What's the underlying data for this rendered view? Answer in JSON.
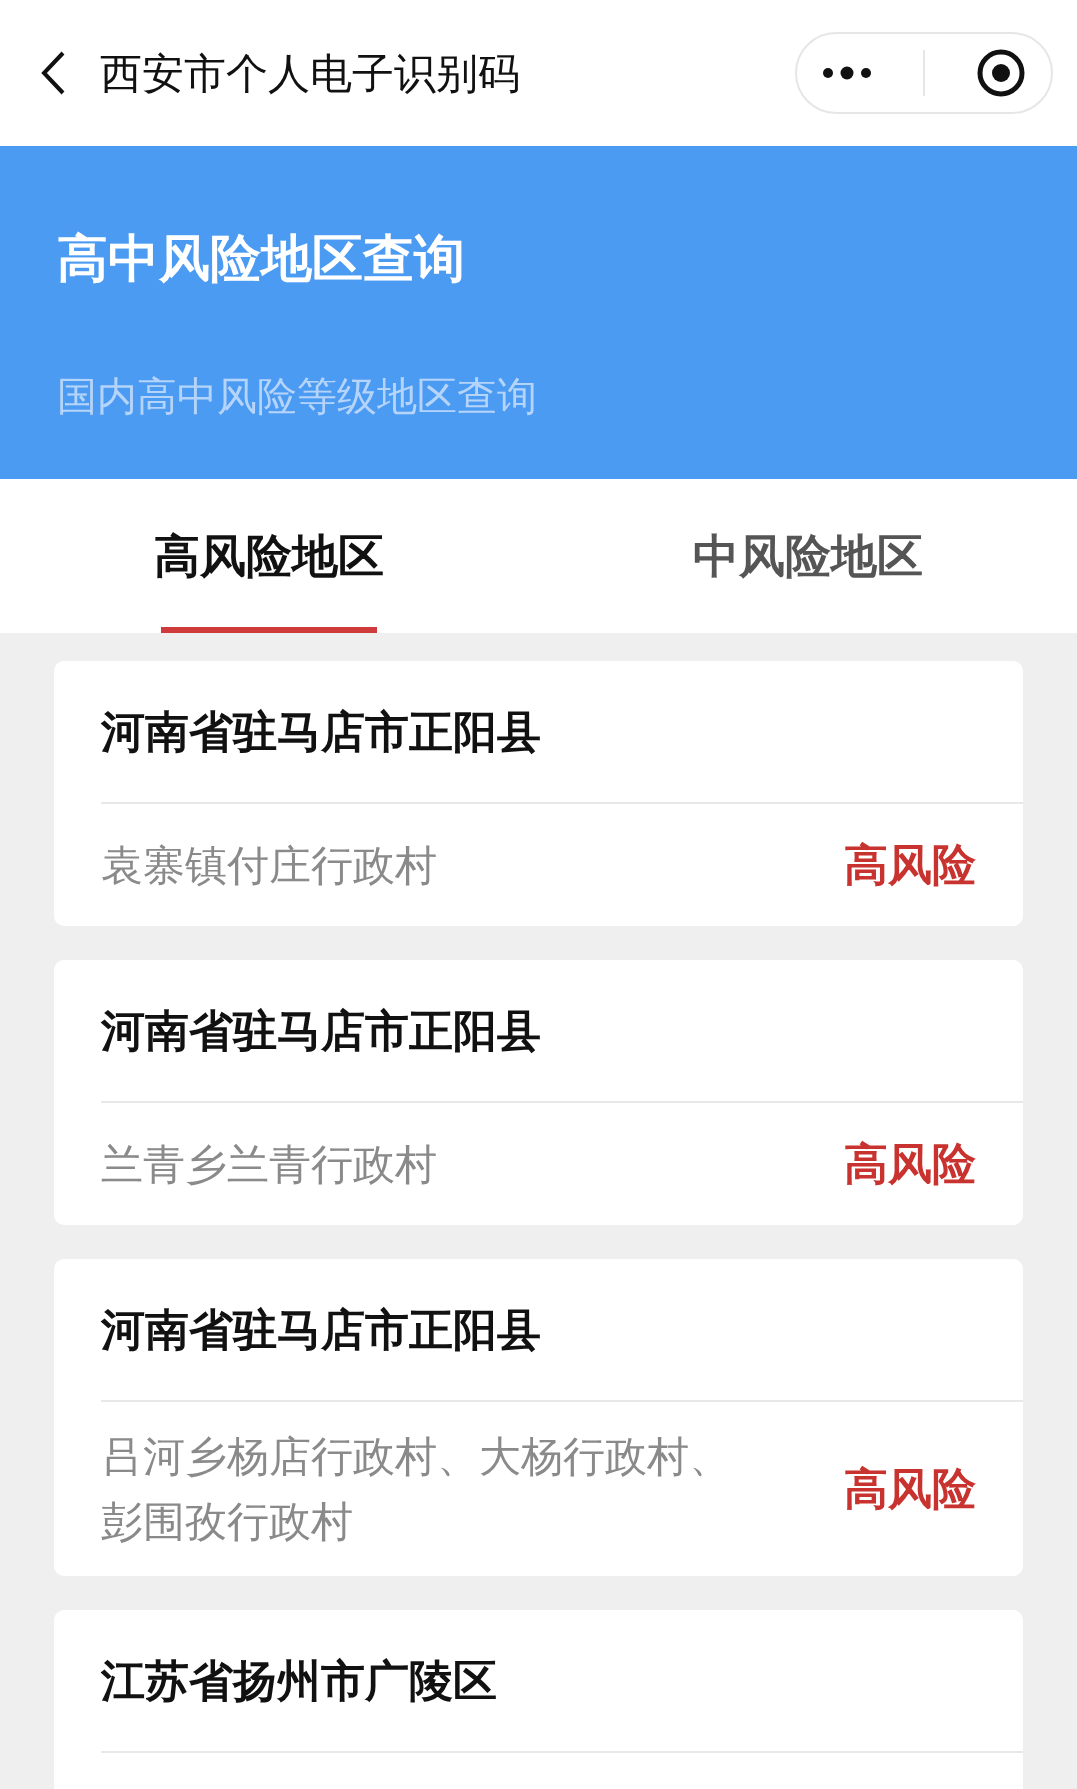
{
  "nav": {
    "title": "西安市个人电子识别码"
  },
  "header": {
    "title": "高中风险地区查询",
    "subtitle": "国内高中风险等级地区查询"
  },
  "tabs": [
    {
      "label": "高风险地区",
      "selected": true
    },
    {
      "label": "中风险地区",
      "selected": false
    }
  ],
  "areas": [
    {
      "region": "河南省驻马店市正阳县",
      "detail": "袁寨镇付庄行政村",
      "risk": "高风险"
    },
    {
      "region": "河南省驻马店市正阳县",
      "detail": "兰青乡兰青行政村",
      "risk": "高风险"
    },
    {
      "region": "河南省驻马店市正阳县",
      "detail": "吕河乡杨店行政村、大杨行政村、彭围孜行政村",
      "risk": "高风险"
    },
    {
      "region": "江苏省扬州市广陵区"
    }
  ]
}
